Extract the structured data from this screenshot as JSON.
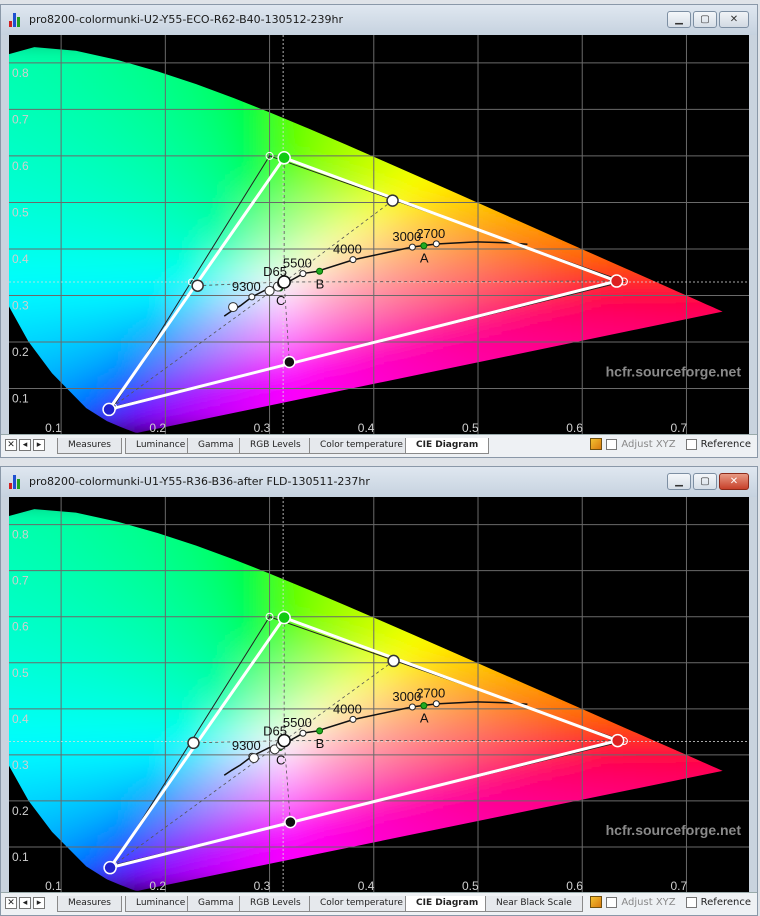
{
  "windows": [
    {
      "title": "pro8200-colormunki-U2-Y55-ECO-R62-B40-130512-239hr",
      "tabs": [
        "Measures",
        "Luminance",
        "Gamma",
        "RGB Levels",
        "Color temperature",
        "CIE Diagram"
      ],
      "active_tab": "CIE Diagram",
      "adjust_label": "Adjust XYZ",
      "reference_label": "Reference"
    },
    {
      "title": "pro8200-colormunki-U1-Y55-R36-B36-after FLD-130511-237hr",
      "tabs": [
        "Measures",
        "Luminance",
        "Gamma",
        "RGB Levels",
        "Color temperature",
        "CIE Diagram",
        "Near Black Scale"
      ],
      "active_tab": "CIE Diagram",
      "adjust_label": "Adjust XYZ",
      "reference_label": "Reference"
    }
  ],
  "colors": {
    "background": "#000000",
    "grid": "#6a6a6a",
    "gamut_white": "#ffffff",
    "watermark": "#8a8a8a"
  },
  "chart_data": [
    {
      "type": "scatter",
      "title": "",
      "xlabel": "",
      "ylabel": "",
      "xlim": [
        0.05,
        0.76
      ],
      "ylim": [
        0.0,
        0.86
      ],
      "x_ticks": [
        "0.1",
        "0.2",
        "0.3",
        "0.4",
        "0.5",
        "0.6",
        "0.7"
      ],
      "y_ticks": [
        "0.1",
        "0.2",
        "0.3",
        "0.4",
        "0.5",
        "0.6",
        "0.7",
        "0.8"
      ],
      "watermark": "hcfr.sourceforge.net",
      "reference_gamut": [
        [
          0.64,
          0.33
        ],
        [
          0.3,
          0.6
        ],
        [
          0.15,
          0.06
        ]
      ],
      "measured_gamut": [
        [
          0.633,
          0.331
        ],
        [
          0.314,
          0.596
        ],
        [
          0.146,
          0.055
        ]
      ],
      "secondaries": [
        [
          0.418,
          0.504
        ],
        [
          0.319,
          0.157
        ],
        [
          0.231,
          0.321
        ]
      ],
      "reference_secondaries": [
        [
          0.419,
          0.505
        ],
        [
          0.321,
          0.154
        ],
        [
          0.225,
          0.329
        ]
      ],
      "white_point": [
        0.314,
        0.329
      ],
      "crosshair": [
        0.313,
        0.329
      ],
      "blackbody_labels": [
        {
          "label": "9300",
          "x": 0.283,
          "y": 0.297
        },
        {
          "label": "D65",
          "x": 0.313,
          "y": 0.329
        },
        {
          "label": "5500",
          "x": 0.332,
          "y": 0.347
        },
        {
          "label": "4000",
          "x": 0.38,
          "y": 0.377
        },
        {
          "label": "3000",
          "x": 0.437,
          "y": 0.404
        },
        {
          "label": "2700",
          "x": 0.46,
          "y": 0.411
        }
      ],
      "illuminants": [
        {
          "label": "A",
          "x": 0.448,
          "y": 0.407
        },
        {
          "label": "B",
          "x": 0.348,
          "y": 0.352
        },
        {
          "label": "C",
          "x": 0.31,
          "y": 0.316
        }
      ],
      "grayscale_points": [
        [
          0.265,
          0.275
        ],
        [
          0.3,
          0.31
        ],
        [
          0.308,
          0.319
        ],
        [
          0.312,
          0.326
        ],
        [
          0.314,
          0.329
        ]
      ]
    },
    {
      "type": "scatter",
      "title": "",
      "xlabel": "",
      "ylabel": "",
      "xlim": [
        0.05,
        0.76
      ],
      "ylim": [
        0.0,
        0.86
      ],
      "x_ticks": [
        "0.1",
        "0.2",
        "0.3",
        "0.4",
        "0.5",
        "0.6",
        "0.7"
      ],
      "y_ticks": [
        "0.1",
        "0.2",
        "0.3",
        "0.4",
        "0.5",
        "0.6",
        "0.7",
        "0.8"
      ],
      "watermark": "hcfr.sourceforge.net",
      "reference_gamut": [
        [
          0.64,
          0.33
        ],
        [
          0.3,
          0.6
        ],
        [
          0.15,
          0.06
        ]
      ],
      "measured_gamut": [
        [
          0.634,
          0.331
        ],
        [
          0.314,
          0.598
        ],
        [
          0.147,
          0.055
        ]
      ],
      "secondaries": [
        [
          0.419,
          0.504
        ],
        [
          0.32,
          0.154
        ],
        [
          0.227,
          0.326
        ]
      ],
      "reference_secondaries": [
        [
          0.419,
          0.505
        ],
        [
          0.321,
          0.154
        ],
        [
          0.225,
          0.329
        ]
      ],
      "white_point": [
        0.314,
        0.331
      ],
      "crosshair": [
        0.313,
        0.329
      ],
      "blackbody_labels": [
        {
          "label": "9300",
          "x": 0.283,
          "y": 0.297
        },
        {
          "label": "D65",
          "x": 0.313,
          "y": 0.329
        },
        {
          "label": "5500",
          "x": 0.332,
          "y": 0.347
        },
        {
          "label": "4000",
          "x": 0.38,
          "y": 0.377
        },
        {
          "label": "3000",
          "x": 0.437,
          "y": 0.404
        },
        {
          "label": "2700",
          "x": 0.46,
          "y": 0.411
        }
      ],
      "illuminants": [
        {
          "label": "A",
          "x": 0.448,
          "y": 0.407
        },
        {
          "label": "B",
          "x": 0.348,
          "y": 0.352
        },
        {
          "label": "C",
          "x": 0.31,
          "y": 0.316
        }
      ],
      "grayscale_points": [
        [
          0.285,
          0.293
        ],
        [
          0.305,
          0.312
        ],
        [
          0.311,
          0.322
        ],
        [
          0.313,
          0.328
        ],
        [
          0.315,
          0.332
        ]
      ]
    }
  ]
}
